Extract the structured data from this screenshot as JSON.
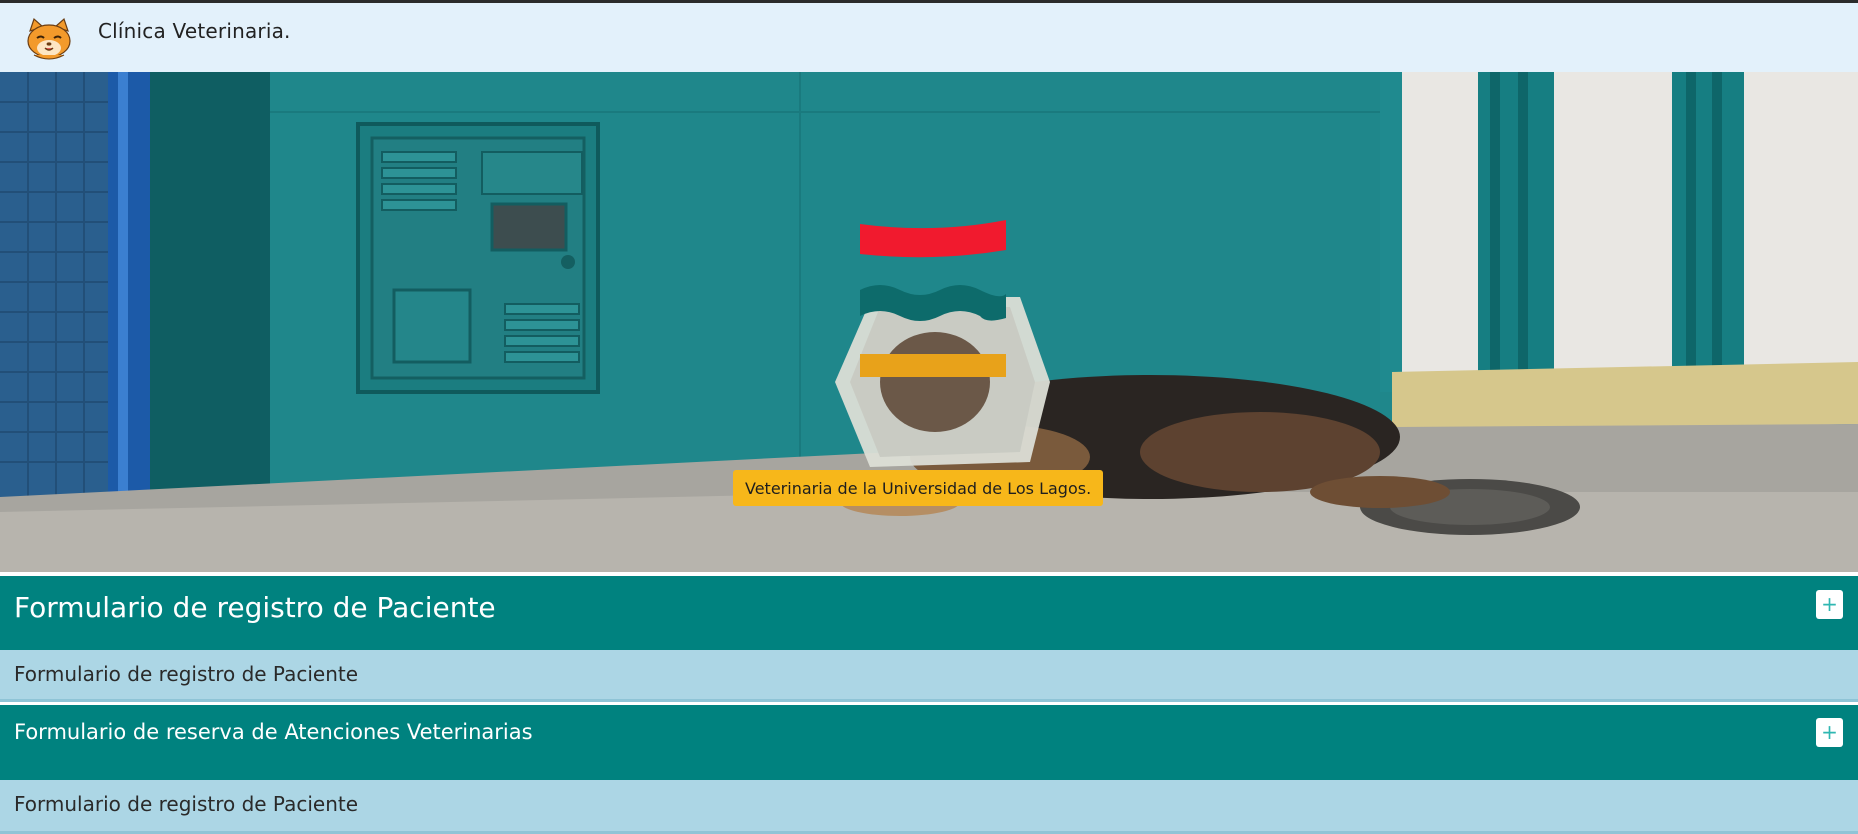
{
  "navbar": {
    "brand_title": "Clínica Veterinaria.",
    "logo_icon": "cat-face-icon"
  },
  "hero": {
    "badge_text": "Veterinaria de la Universidad de Los Lagos.",
    "image_subject": "dog-with-cone-icon"
  },
  "sections": [
    {
      "header_title": "Formulario de registro de Paciente",
      "toggle_label": "+",
      "body_text": "Formulario de registro de Paciente"
    },
    {
      "header_title": "Formulario de reserva de Atenciones Veterinarias",
      "toggle_label": "+",
      "body_text": "Formulario de registro de Paciente"
    }
  ],
  "colors": {
    "navbar_bg": "#e3f1fb",
    "section_header_bg": "#00827f",
    "section_body_bg": "#acd6e5",
    "badge_bg": "#f7b71a"
  }
}
